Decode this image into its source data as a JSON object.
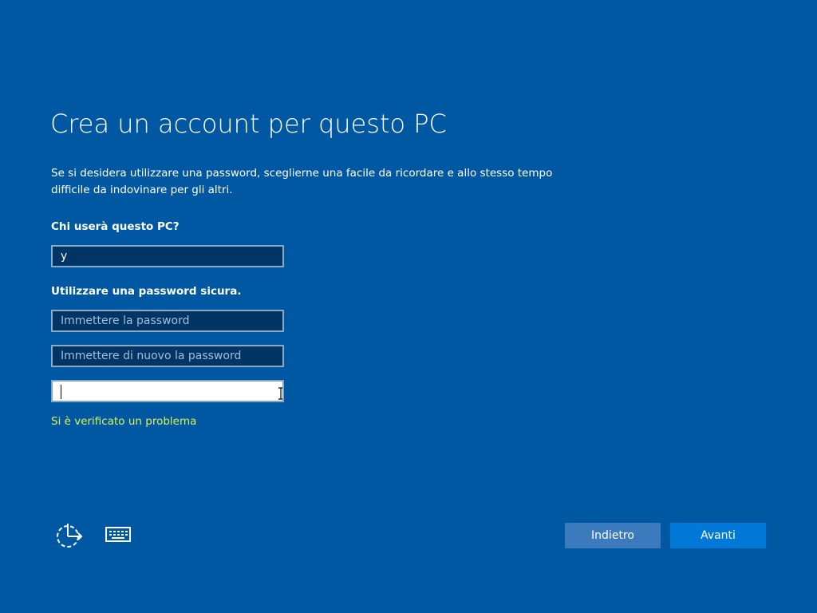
{
  "page": {
    "title": "Crea un account per questo PC",
    "description": "Se si desidera utilizzare una password, sceglierne una facile da ricordare e allo stesso tempo difficile da indovinare per gli altri."
  },
  "form": {
    "username_label": "Chi userà questo PC?",
    "username_value": "y",
    "password_label": "Utilizzare una password sicura.",
    "password_placeholder": "Immettere la password",
    "confirm_placeholder": "Immettere di nuovo la password",
    "hint_value": "",
    "error_message": "Si è verificato un problema"
  },
  "footer": {
    "accessibility_icon": "ease-of-access-icon",
    "keyboard_icon": "keyboard-icon",
    "back_label": "Indietro",
    "next_label": "Avanti"
  },
  "colors": {
    "background": "#0058a3",
    "field_bg": "#003566",
    "error": "#dff251",
    "next_button": "#0078d7",
    "back_button": "#3a7abd"
  }
}
